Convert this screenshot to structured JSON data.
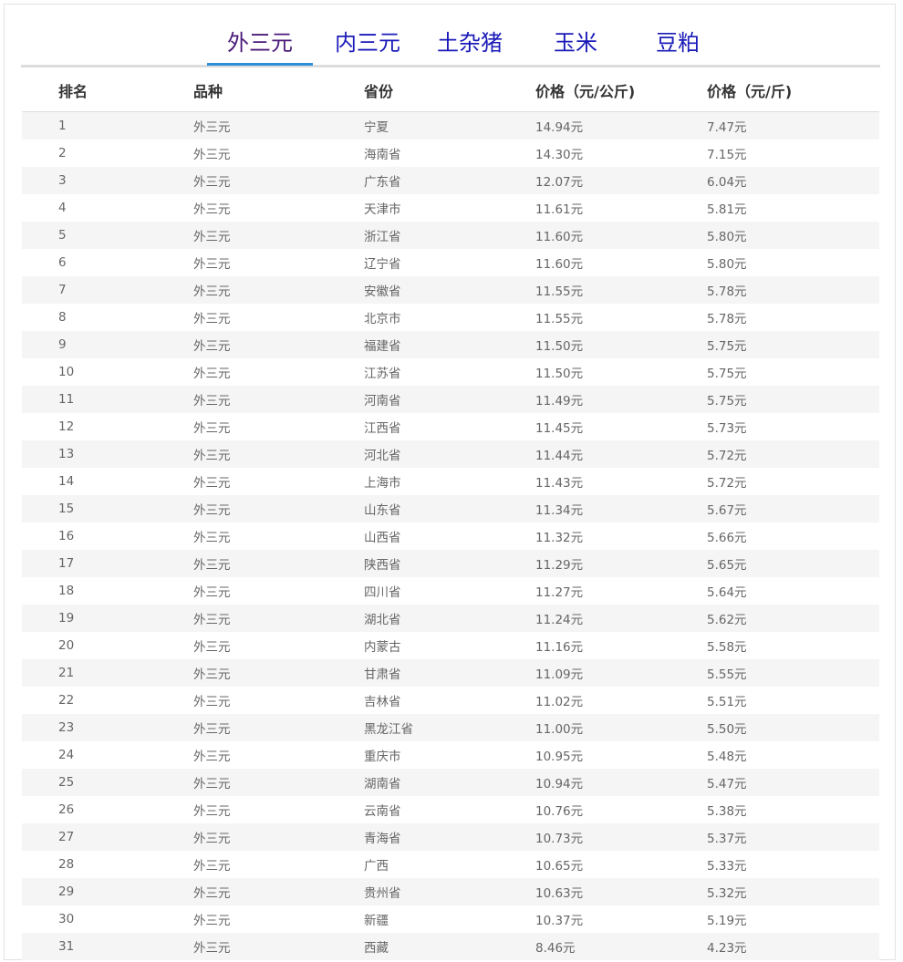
{
  "tabs": [
    {
      "label": "外三元",
      "active": true
    },
    {
      "label": "内三元",
      "active": false
    },
    {
      "label": "土杂猪",
      "active": false
    },
    {
      "label": "玉米",
      "active": false
    },
    {
      "label": "豆粕",
      "active": false
    }
  ],
  "table": {
    "headers": [
      "排名",
      "品种",
      "省份",
      "价格（元/公斤)",
      "价格（元/斤)"
    ],
    "rows": [
      [
        "1",
        "外三元",
        "宁夏",
        "14.94元",
        "7.47元"
      ],
      [
        "2",
        "外三元",
        "海南省",
        "14.30元",
        "7.15元"
      ],
      [
        "3",
        "外三元",
        "广东省",
        "12.07元",
        "6.04元"
      ],
      [
        "4",
        "外三元",
        "天津市",
        "11.61元",
        "5.81元"
      ],
      [
        "5",
        "外三元",
        "浙江省",
        "11.60元",
        "5.80元"
      ],
      [
        "6",
        "外三元",
        "辽宁省",
        "11.60元",
        "5.80元"
      ],
      [
        "7",
        "外三元",
        "安徽省",
        "11.55元",
        "5.78元"
      ],
      [
        "8",
        "外三元",
        "北京市",
        "11.55元",
        "5.78元"
      ],
      [
        "9",
        "外三元",
        "福建省",
        "11.50元",
        "5.75元"
      ],
      [
        "10",
        "外三元",
        "江苏省",
        "11.50元",
        "5.75元"
      ],
      [
        "11",
        "外三元",
        "河南省",
        "11.49元",
        "5.75元"
      ],
      [
        "12",
        "外三元",
        "江西省",
        "11.45元",
        "5.73元"
      ],
      [
        "13",
        "外三元",
        "河北省",
        "11.44元",
        "5.72元"
      ],
      [
        "14",
        "外三元",
        "上海市",
        "11.43元",
        "5.72元"
      ],
      [
        "15",
        "外三元",
        "山东省",
        "11.34元",
        "5.67元"
      ],
      [
        "16",
        "外三元",
        "山西省",
        "11.32元",
        "5.66元"
      ],
      [
        "17",
        "外三元",
        "陕西省",
        "11.29元",
        "5.65元"
      ],
      [
        "18",
        "外三元",
        "四川省",
        "11.27元",
        "5.64元"
      ],
      [
        "19",
        "外三元",
        "湖北省",
        "11.24元",
        "5.62元"
      ],
      [
        "20",
        "外三元",
        "内蒙古",
        "11.16元",
        "5.58元"
      ],
      [
        "21",
        "外三元",
        "甘肃省",
        "11.09元",
        "5.55元"
      ],
      [
        "22",
        "外三元",
        "吉林省",
        "11.02元",
        "5.51元"
      ],
      [
        "23",
        "外三元",
        "黑龙江省",
        "11.00元",
        "5.50元"
      ],
      [
        "24",
        "外三元",
        "重庆市",
        "10.95元",
        "5.48元"
      ],
      [
        "25",
        "外三元",
        "湖南省",
        "10.94元",
        "5.47元"
      ],
      [
        "26",
        "外三元",
        "云南省",
        "10.76元",
        "5.38元"
      ],
      [
        "27",
        "外三元",
        "青海省",
        "10.73元",
        "5.37元"
      ],
      [
        "28",
        "外三元",
        "广西",
        "10.65元",
        "5.33元"
      ],
      [
        "29",
        "外三元",
        "贵州省",
        "10.63元",
        "5.32元"
      ],
      [
        "30",
        "外三元",
        "新疆",
        "10.37元",
        "5.19元"
      ],
      [
        "31",
        "外三元",
        "西藏",
        "8.46元",
        "4.23元"
      ]
    ]
  }
}
